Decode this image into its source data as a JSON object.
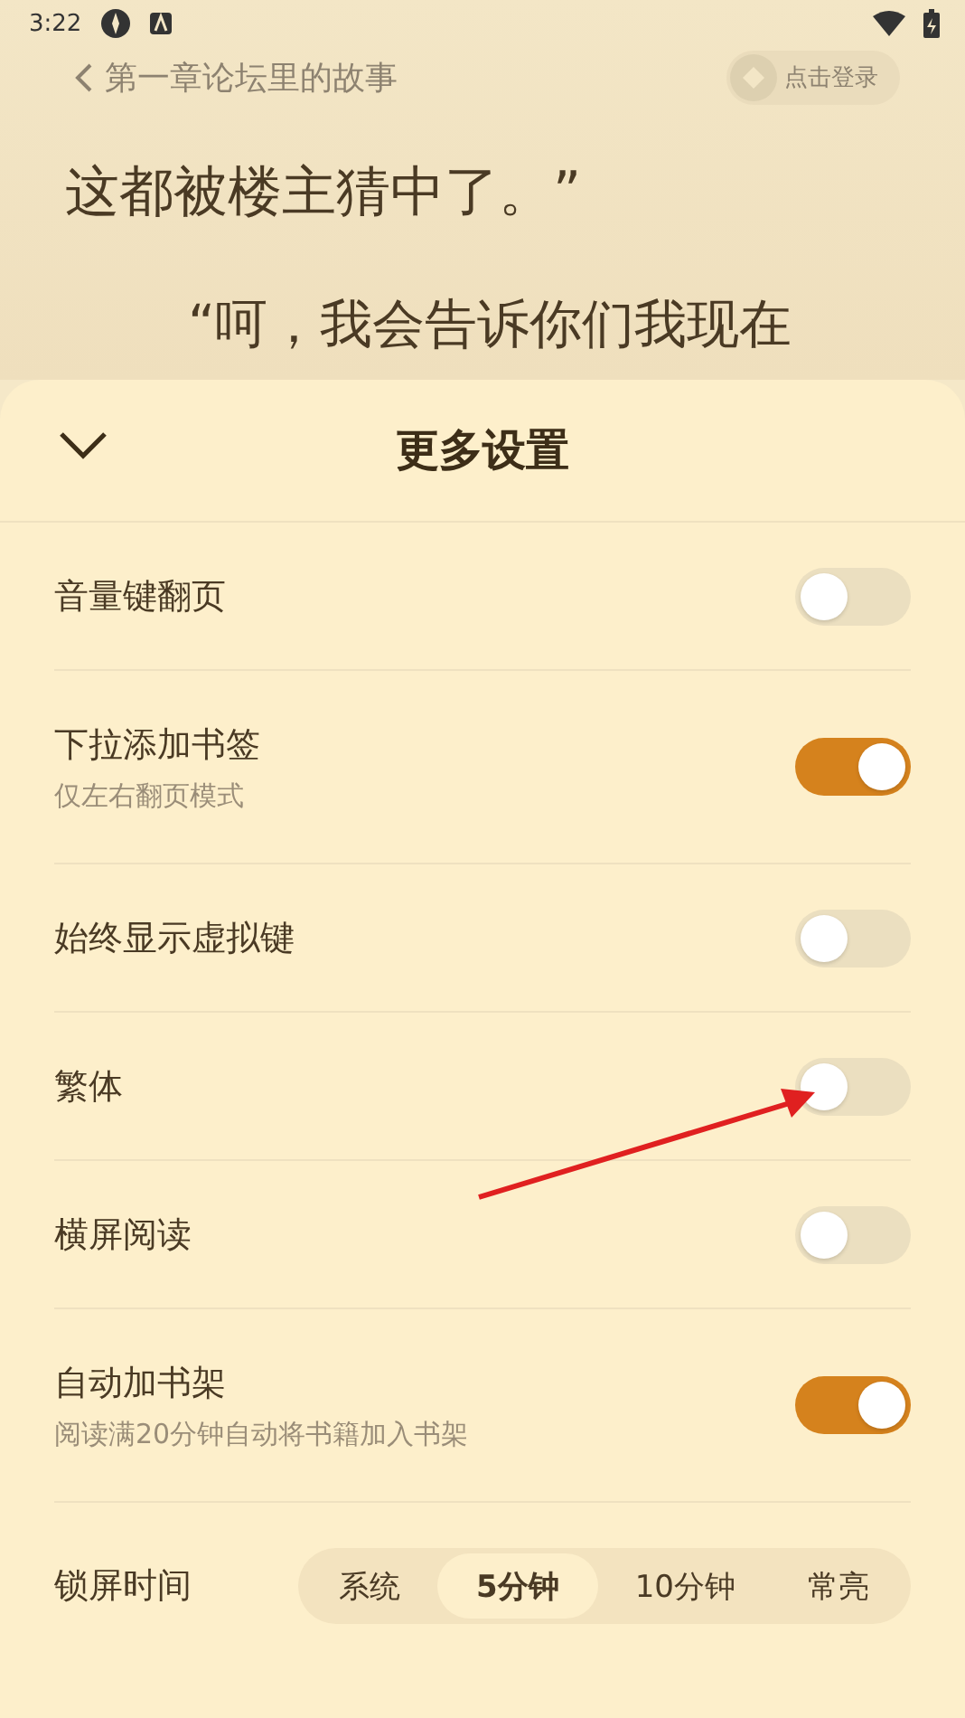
{
  "status_bar": {
    "time": "3:22"
  },
  "reader": {
    "chapter_title": "第一章论坛里的故事",
    "login_button": "点击登录",
    "lines": [
      "这都被楼主猜中了。”",
      "“呵，我会告诉你们我现在"
    ]
  },
  "sheet": {
    "title": "更多设置",
    "settings": [
      {
        "label": "音量键翻页",
        "on": false
      },
      {
        "label": "下拉添加书签",
        "subtitle": "仅左右翻页模式",
        "on": true
      },
      {
        "label": "始终显示虚拟键",
        "on": false
      },
      {
        "label": "繁体",
        "on": false
      },
      {
        "label": "横屏阅读",
        "on": false
      },
      {
        "label": "自动加书架",
        "subtitle": "阅读满20分钟自动将书籍加入书架",
        "on": true
      }
    ],
    "lock_screen": {
      "label": "锁屏时间",
      "options": [
        {
          "label": "系统",
          "selected": false
        },
        {
          "label": "5分钟",
          "selected": true
        },
        {
          "label": "10分钟",
          "selected": false
        },
        {
          "label": "常亮",
          "selected": false
        }
      ]
    }
  },
  "annotation": {
    "kind": "arrow"
  }
}
